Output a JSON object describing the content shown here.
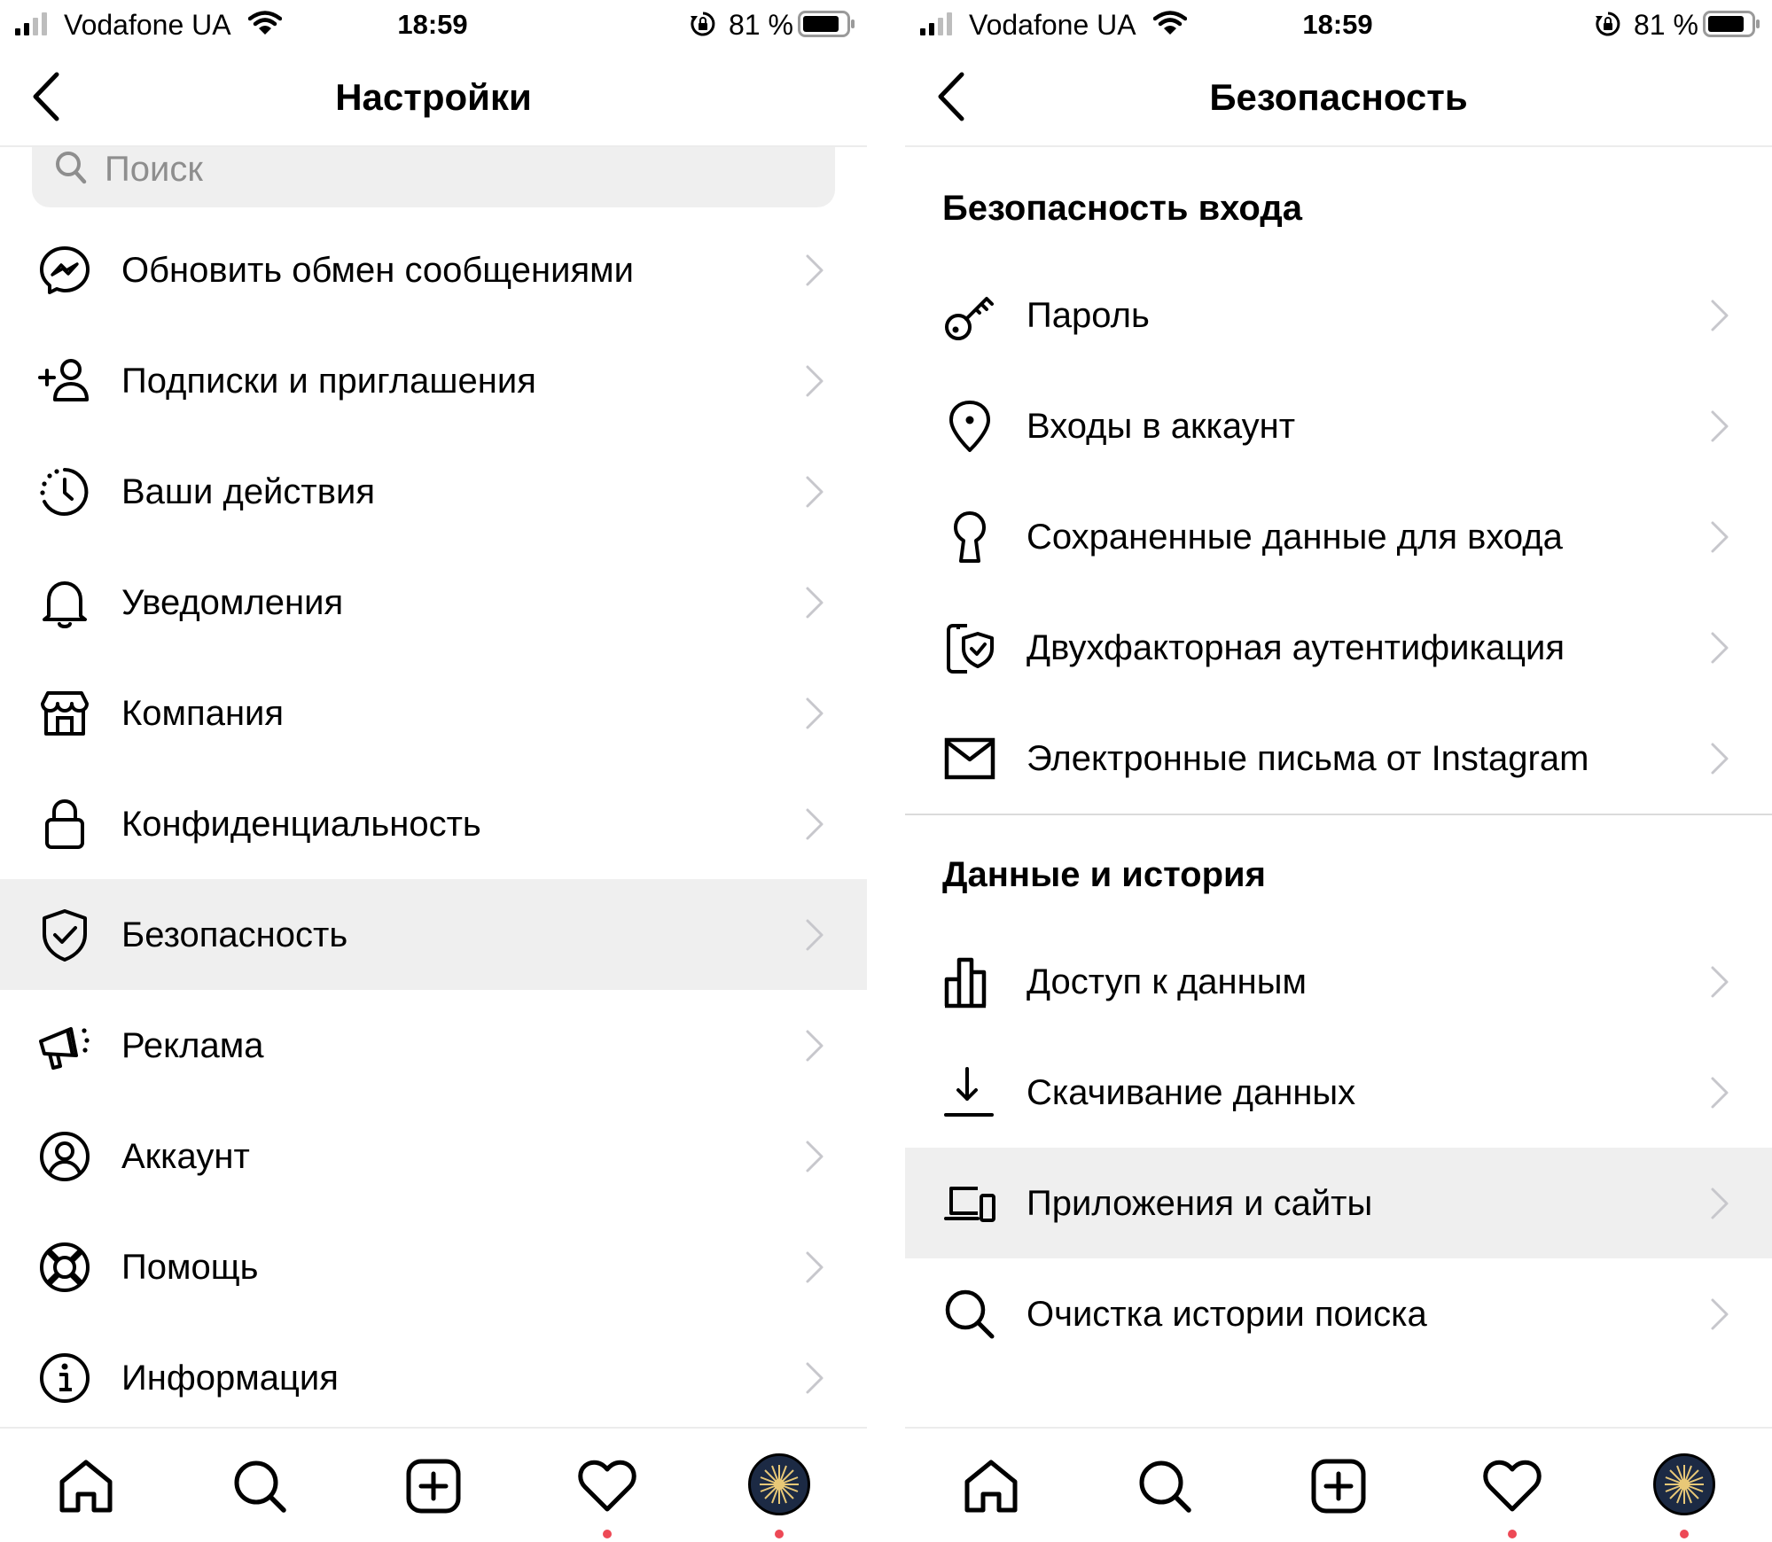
{
  "status_bar": {
    "carrier": "Vodafone UA",
    "time": "18:59",
    "battery_percent": "81 %"
  },
  "left_screen": {
    "title": "Настройки",
    "search_placeholder": "Поиск",
    "items": [
      {
        "label": "Обновить обмен сообщениями",
        "icon": "messenger-icon"
      },
      {
        "label": "Подписки и приглашения",
        "icon": "add-person-icon"
      },
      {
        "label": "Ваши действия",
        "icon": "activity-clock-icon"
      },
      {
        "label": "Уведомления",
        "icon": "bell-icon"
      },
      {
        "label": "Компания",
        "icon": "shop-icon"
      },
      {
        "label": "Конфиденциальность",
        "icon": "lock-icon"
      },
      {
        "label": "Безопасность",
        "icon": "shield-check-icon",
        "selected": true
      },
      {
        "label": "Реклама",
        "icon": "megaphone-icon"
      },
      {
        "label": "Аккаунт",
        "icon": "account-circle-icon"
      },
      {
        "label": "Помощь",
        "icon": "lifebuoy-icon"
      },
      {
        "label": "Информация",
        "icon": "info-icon"
      }
    ]
  },
  "right_screen": {
    "title": "Безопасность",
    "section_login": {
      "header": "Безопасность входа",
      "items": [
        {
          "label": "Пароль",
          "icon": "key-icon"
        },
        {
          "label": "Входы в аккаунт",
          "icon": "location-pin-icon"
        },
        {
          "label": "Сохраненные данные для входа",
          "icon": "keyhole-icon"
        },
        {
          "label": "Двухфакторная аутентификация",
          "icon": "phone-shield-icon"
        },
        {
          "label": "Электронные письма от Instagram",
          "icon": "envelope-icon"
        }
      ]
    },
    "section_data": {
      "header": "Данные и история",
      "items": [
        {
          "label": "Доступ к данным",
          "icon": "bar-chart-icon"
        },
        {
          "label": "Скачивание данных",
          "icon": "download-icon"
        },
        {
          "label": "Приложения и сайты",
          "icon": "devices-icon",
          "selected": true
        },
        {
          "label": "Очистка истории поиска",
          "icon": "search-icon"
        }
      ]
    }
  },
  "tab_bar": {
    "tabs": [
      "home-icon",
      "search-icon",
      "new-post-icon",
      "activity-heart-icon",
      "profile-avatar"
    ],
    "notification_dot_color": "#ed4956"
  },
  "colors": {
    "selected_row": "#efefef",
    "search_background": "#efefef",
    "placeholder": "#8e8e8e"
  }
}
